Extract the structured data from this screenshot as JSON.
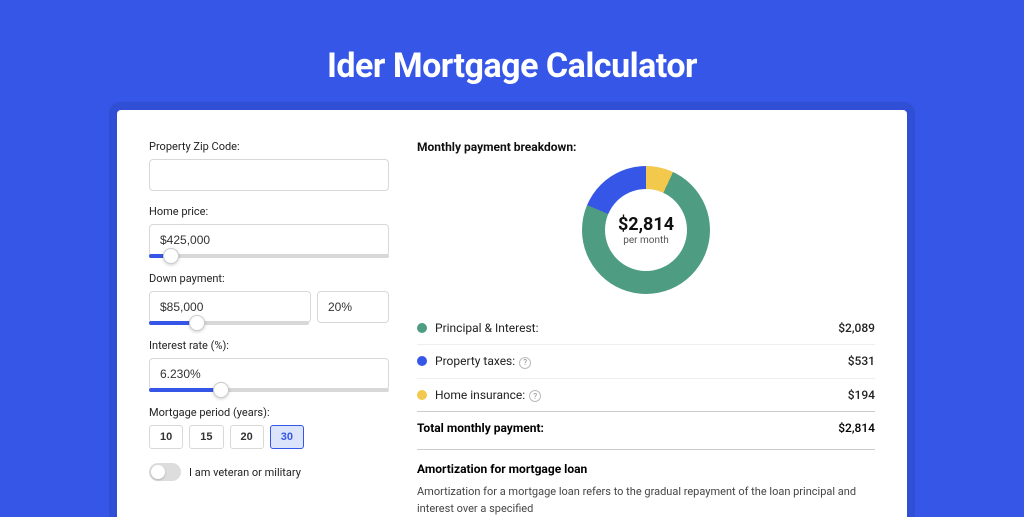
{
  "title": "Ider Mortgage Calculator",
  "form": {
    "zip_label": "Property Zip Code:",
    "zip_value": "",
    "home_price_label": "Home price:",
    "home_price_value": "$425,000",
    "down_payment_label": "Down payment:",
    "down_payment_value": "$85,000",
    "down_payment_pct": "20%",
    "interest_label": "Interest rate (%):",
    "interest_value": "6.230%",
    "period_label": "Mortgage period (years):",
    "periods": [
      "10",
      "15",
      "20",
      "30"
    ],
    "period_selected": "30",
    "veteran_label": "I am veteran or military"
  },
  "breakdown": {
    "title": "Monthly payment breakdown:",
    "total_value": "$2,814",
    "total_sub": "per month",
    "items": [
      {
        "label": "Principal & Interest:",
        "value": "$2,089",
        "color": "#4e9c81",
        "info": false
      },
      {
        "label": "Property taxes:",
        "value": "$531",
        "color": "#3656e8",
        "info": true
      },
      {
        "label": "Home insurance:",
        "value": "$194",
        "color": "#f2c94c",
        "info": true
      }
    ],
    "total_label": "Total monthly payment:",
    "total_row_value": "$2,814"
  },
  "amortization": {
    "title": "Amortization for mortgage loan",
    "text": "Amortization for a mortgage loan refers to the gradual repayment of the loan principal and interest over a specified"
  },
  "chart_data": {
    "type": "pie",
    "title": "Monthly payment breakdown",
    "series": [
      {
        "name": "Principal & Interest",
        "value": 2089,
        "color": "#4e9c81"
      },
      {
        "name": "Property taxes",
        "value": 531,
        "color": "#3656e8"
      },
      {
        "name": "Home insurance",
        "value": 194,
        "color": "#f2c94c"
      }
    ],
    "total": 2814,
    "unit": "USD/month"
  }
}
